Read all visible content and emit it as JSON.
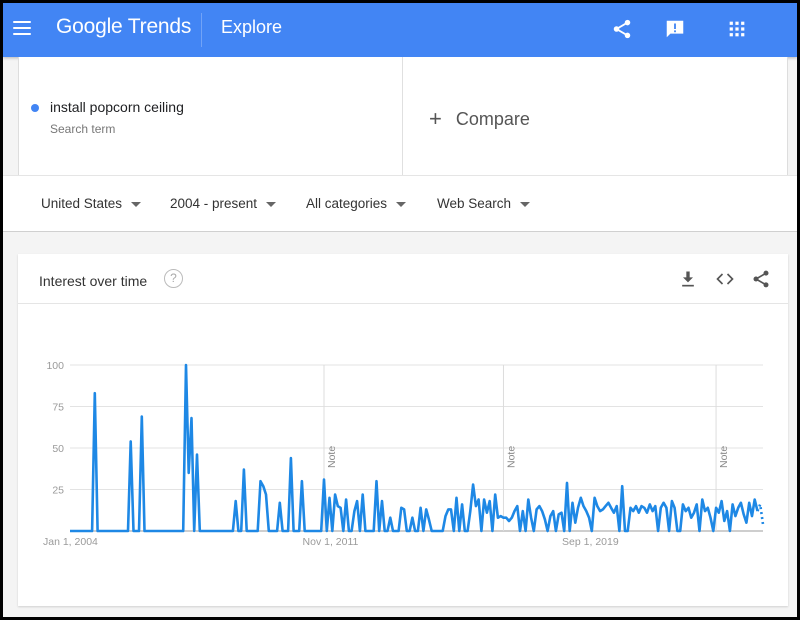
{
  "header": {
    "brand_google": "Google",
    "brand_trends": "Trends",
    "section": "Explore",
    "icons": [
      "menu-icon",
      "share-icon",
      "feedback-icon",
      "apps-grid-icon"
    ],
    "brand_color": "#4285f4"
  },
  "search": {
    "term": "install popcorn ceiling",
    "term_type": "Search term",
    "term_color": "#4285f4",
    "compare_label": "Compare"
  },
  "filters": {
    "region": "United States",
    "time_range": "2004 - present",
    "category": "All categories",
    "search_type": "Web Search"
  },
  "card": {
    "title": "Interest over time",
    "help_glyph": "?",
    "icons": [
      "download-icon",
      "embed-icon",
      "share-icon"
    ]
  },
  "chart_data": {
    "type": "line",
    "title": "Interest over time",
    "series_name": "install popcorn ceiling",
    "series_color": "#1e88e5",
    "start": "2004-01",
    "frequency": "monthly",
    "ylim": [
      0,
      100
    ],
    "yticks": [
      25,
      50,
      75,
      100
    ],
    "xtick_labels": [
      "Jan 1, 2004",
      "Nov 1, 2011",
      "Sep 1, 2019"
    ],
    "xtick_months": [
      0,
      94,
      188
    ],
    "notes": [
      {
        "label": "Note",
        "month": 92
      },
      {
        "label": "Note",
        "month": 157
      },
      {
        "label": "Note",
        "month": 234
      }
    ],
    "grid": true,
    "partial_last_points": 2,
    "values": [
      0,
      0,
      0,
      0,
      0,
      0,
      0,
      0,
      0,
      83,
      0,
      0,
      0,
      0,
      0,
      0,
      0,
      0,
      0,
      0,
      0,
      0,
      54,
      0,
      0,
      0,
      69,
      0,
      0,
      0,
      0,
      0,
      0,
      0,
      0,
      0,
      0,
      0,
      0,
      0,
      0,
      0,
      100,
      35,
      68,
      0,
      46,
      0,
      0,
      0,
      0,
      0,
      0,
      0,
      0,
      0,
      0,
      0,
      0,
      0,
      18,
      0,
      0,
      37,
      0,
      0,
      0,
      0,
      0,
      30,
      27,
      22,
      0,
      0,
      0,
      0,
      17,
      0,
      0,
      0,
      44,
      0,
      0,
      0,
      30,
      0,
      0,
      0,
      0,
      0,
      0,
      0,
      31,
      0,
      20,
      0,
      22,
      15,
      14,
      0,
      19,
      0,
      0,
      12,
      18,
      0,
      22,
      0,
      0,
      0,
      0,
      30,
      0,
      18,
      0,
      0,
      8,
      0,
      0,
      0,
      14,
      13,
      0,
      0,
      8,
      0,
      0,
      14,
      0,
      13,
      7,
      0,
      0,
      0,
      0,
      0,
      9,
      13,
      13,
      0,
      20,
      0,
      16,
      0,
      0,
      12,
      28,
      15,
      19,
      0,
      19,
      11,
      18,
      0,
      22,
      8,
      9,
      8,
      8,
      6,
      8,
      12,
      15,
      0,
      12,
      0,
      19,
      8,
      0,
      13,
      15,
      12,
      7,
      0,
      9,
      12,
      0,
      10,
      11,
      0,
      29,
      0,
      17,
      5,
      14,
      20,
      15,
      12,
      8,
      0,
      20,
      15,
      12,
      13,
      15,
      17,
      14,
      11,
      15,
      0,
      27,
      0,
      0,
      14,
      12,
      15,
      11,
      15,
      14,
      11,
      16,
      12,
      15,
      0,
      14,
      17,
      14,
      0,
      18,
      14,
      0,
      0,
      16,
      12,
      14,
      8,
      11,
      16,
      0,
      19,
      12,
      14,
      8,
      0,
      14,
      11,
      18,
      6,
      12,
      0,
      16,
      9,
      14,
      17,
      10,
      5,
      17,
      9,
      19,
      12,
      16,
      4
    ]
  }
}
